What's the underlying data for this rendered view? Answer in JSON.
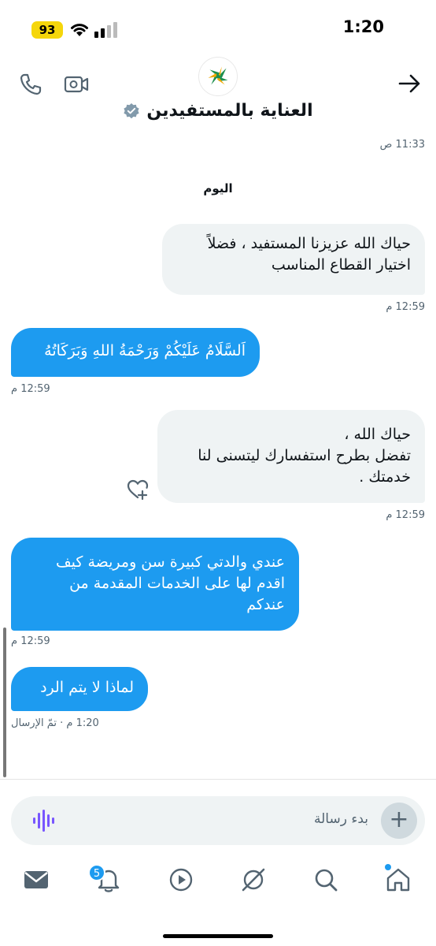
{
  "status_bar": {
    "time": "1:20",
    "battery": "93"
  },
  "header": {
    "title": "العناية بالمستفيدين",
    "verified": true
  },
  "messages": {
    "ts_top": "11:33 ص",
    "day_label": "اليوم",
    "m1": {
      "lines": [
        "حياك الله عزيزنا المستفيد ، فضلاً",
        "اختيار القطاع المناسب"
      ],
      "time": "12:59 م"
    },
    "m2": {
      "lines": [
        "اَلسَّلَامُ عَلَيْكُمْ وَرَحْمَةُ اللهِ وَبَرَكَاتُهُ"
      ],
      "time": "12:59 م"
    },
    "m3": {
      "lines": [
        "حياك الله ،",
        "تفضل بطرح استفسارك ليتسنى لنا",
        "خدمتك ."
      ],
      "time": "12:59 م"
    },
    "m4": {
      "lines": [
        "عندي والدتي كبيرة سن ومريضة كيف",
        "اقدم لها على الخدمات المقدمة من",
        "عندكم"
      ],
      "time": "12:59 م"
    },
    "m5": {
      "lines": [
        "لماذا لا يتم الرد"
      ],
      "time": "1:20 م · تمّ الإرسال"
    }
  },
  "composer": {
    "placeholder": "بدء رسالة"
  },
  "nav": {
    "notifications_badge": "5"
  },
  "colors": {
    "accent": "#1d9bf0",
    "received_bg": "#eff3f4",
    "voice": "#7856ff"
  }
}
